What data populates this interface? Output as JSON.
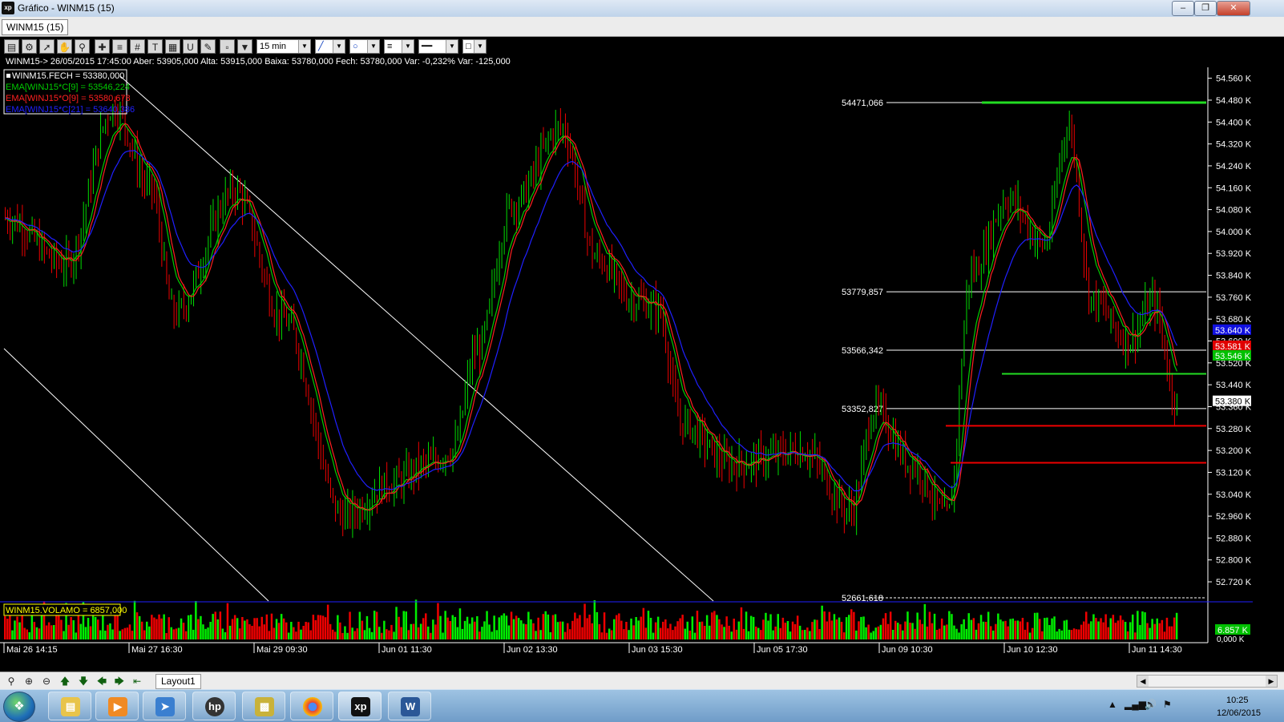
{
  "window": {
    "title": "Gráfico - WINM15 (15)",
    "app_icon": "xp",
    "minimize_icon": "minimize-icon",
    "maximize_icon": "restore-icon",
    "close_icon": "close-icon"
  },
  "tabs": [
    {
      "label": "WINM15 (15)"
    }
  ],
  "toolbar": {
    "timeframe": "15 min",
    "icons": [
      "chart-type-icon",
      "gear-icon",
      "cursor-icon",
      "hand-icon",
      "zoom-icon",
      "crosshair-icon",
      "parallel-lines-icon",
      "grid-icon",
      "text-icon",
      "calculator-icon",
      "magnet-icon",
      "brush-icon",
      "clipboard-icon",
      "filter-icon",
      "line-tool-icon",
      "ellipse-tool-icon",
      "line-style-icon",
      "line-width-icon",
      "color-box-icon"
    ]
  },
  "info_line": "WINM15-> 26/05/2015 17:45:00 Aber: 53905,000 Alta: 53915,000 Baixa: 53780,000 Fech: 53780,000 Var: -0,232% Var: -125,000",
  "legend": [
    {
      "text": "WINM15.FECH = 53380,000",
      "color": "#ffffff"
    },
    {
      "text": "EMA[WINJ15*C[9] = 53546,224",
      "color": "#00cc00"
    },
    {
      "text": "EMA[WINJ15*O[9] = 53580,678",
      "color": "#ff2020"
    },
    {
      "text": "EMA[WINJ15*C[21] = 53640,386",
      "color": "#2020ff"
    }
  ],
  "volume_label": "WINM15.VOLAMO = 6857,000",
  "volume_badge": "6.857 K",
  "volume_zero_label": "0,000 K",
  "colors": {
    "up": "#00dd00",
    "down": "#ee0000",
    "ema9c": "#00cc00",
    "ema9o": "#ff2020",
    "ema21": "#2020ff",
    "volume_up": "#00ee00",
    "volume_down": "#ee0000"
  },
  "chart_data": {
    "type": "candlestick",
    "ylim": [
      52661.618,
      54600
    ],
    "y_ticks": [
      54560,
      54480,
      54400,
      54320,
      54240,
      54160,
      54080,
      54000,
      53920,
      53840,
      53760,
      53680,
      53600,
      53520,
      53440,
      53360,
      53280,
      53200,
      53120,
      53040,
      52960,
      52880,
      52800,
      52720
    ],
    "y_tick_labels": [
      "54.560 K",
      "54.480 K",
      "54.400 K",
      "54.320 K",
      "54.240 K",
      "54.160 K",
      "54.080 K",
      "54.000 K",
      "53.920 K",
      "53.840 K",
      "53.760 K",
      "53.680 K",
      "53.600 K",
      "53.520 K",
      "53.440 K",
      "53.360 K",
      "53.280 K",
      "53.200 K",
      "53.120 K",
      "53.040 K",
      "52.960 K",
      "52.880 K",
      "52.800 K",
      "52.720 K"
    ],
    "x_labels": [
      "Mai 26 14:15",
      "Mai 27 16:30",
      "Mai 29 09:30",
      "Jun 01 11:30",
      "Jun 02 13:30",
      "Jun 03 15:30",
      "Jun 05 17:30",
      "Jun 09 10:30",
      "Jun 10 12:30",
      "Jun 11 14:30"
    ],
    "price_badges": [
      {
        "text": "53.640 K",
        "value": 53640,
        "color": "#1010e0"
      },
      {
        "text": "53.581 K",
        "value": 53581,
        "color": "#e00000"
      },
      {
        "text": "53.546 K",
        "value": 53546,
        "color": "#00c000"
      },
      {
        "text": "53.380 K",
        "value": 53380,
        "color": "#ffffff"
      }
    ],
    "horizontal_levels": [
      {
        "value": 54471.066,
        "label": "54471,066"
      },
      {
        "value": 53779.857,
        "label": "53779,857"
      },
      {
        "value": 53566.342,
        "label": "53566,342"
      },
      {
        "value": 53352.827,
        "label": "53352,827"
      },
      {
        "value": 52661.618,
        "label": "52661,618"
      }
    ],
    "path_anchors": [
      [
        0,
        54050
      ],
      [
        0.05,
        53880
      ],
      [
        0.09,
        54450
      ],
      [
        0.12,
        54160
      ],
      [
        0.14,
        53700
      ],
      [
        0.19,
        54150
      ],
      [
        0.23,
        53680
      ],
      [
        0.28,
        52960
      ],
      [
        0.32,
        53080
      ],
      [
        0.35,
        53150
      ],
      [
        0.37,
        53200
      ],
      [
        0.39,
        53560
      ],
      [
        0.42,
        54100
      ],
      [
        0.46,
        54380
      ],
      [
        0.49,
        53900
      ],
      [
        0.52,
        53750
      ],
      [
        0.54,
        53720
      ],
      [
        0.56,
        53300
      ],
      [
        0.6,
        53150
      ],
      [
        0.66,
        53200
      ],
      [
        0.7,
        52980
      ],
      [
        0.72,
        53350
      ],
      [
        0.75,
        53150
      ],
      [
        0.78,
        52960
      ],
      [
        0.8,
        53850
      ],
      [
        0.83,
        54120
      ],
      [
        0.86,
        53950
      ],
      [
        0.88,
        54380
      ],
      [
        0.9,
        53750
      ],
      [
        0.93,
        53600
      ],
      [
        0.95,
        53740
      ],
      [
        0.97,
        53380
      ]
    ]
  }
}
